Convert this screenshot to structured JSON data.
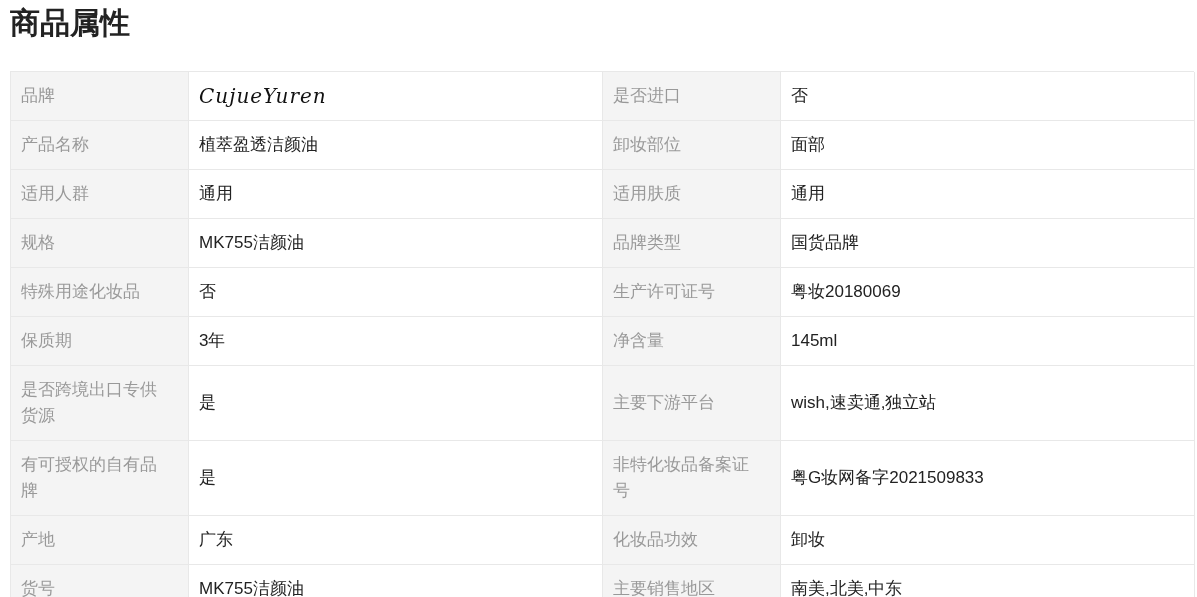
{
  "title": "商品属性",
  "rows": [
    {
      "cells": [
        {
          "label": "品牌",
          "value": "CujueYuren",
          "kind": "script"
        },
        {
          "label": "是否进口",
          "value": "否",
          "kind": "text"
        }
      ]
    },
    {
      "cells": [
        {
          "label": "产品名称",
          "value": "植萃盈透洁颜油",
          "kind": "text"
        },
        {
          "label": "卸妆部位",
          "value": "面部",
          "kind": "text"
        }
      ]
    },
    {
      "cells": [
        {
          "label": "适用人群",
          "value": "通用",
          "kind": "text"
        },
        {
          "label": "适用肤质",
          "value": "通用",
          "kind": "text"
        }
      ]
    },
    {
      "cells": [
        {
          "label": "规格",
          "value": "MK755洁颜油",
          "kind": "text"
        },
        {
          "label": "品牌类型",
          "value": "国货品牌",
          "kind": "text"
        }
      ]
    },
    {
      "cells": [
        {
          "label": "特殊用途化妆品",
          "value": "否",
          "kind": "text"
        },
        {
          "label": "生产许可证号",
          "value": "粤妆20180069",
          "kind": "text"
        }
      ]
    },
    {
      "cells": [
        {
          "label": "保质期",
          "value": "3年",
          "kind": "text"
        },
        {
          "label": "净含量",
          "value": "145ml",
          "kind": "text"
        }
      ]
    },
    {
      "cells": [
        {
          "label": "是否跨境出口专供货源",
          "value": "是",
          "kind": "text"
        },
        {
          "label": "主要下游平台",
          "value": "wish,速卖通,独立站",
          "kind": "text"
        }
      ]
    },
    {
      "cells": [
        {
          "label": "有可授权的自有品牌",
          "value": "是",
          "kind": "text"
        },
        {
          "label": "非特化妆品备案证号",
          "value": "粤G妆网备字2021509833",
          "kind": "text"
        }
      ]
    },
    {
      "cells": [
        {
          "label": "产地",
          "value": "广东",
          "kind": "text"
        },
        {
          "label": "化妆品功效",
          "value": "卸妆",
          "kind": "text"
        }
      ]
    },
    {
      "cells": [
        {
          "label": "货号",
          "value": "MK755洁颜油",
          "kind": "text"
        },
        {
          "label": "主要销售地区",
          "value": "南美,北美,中东",
          "kind": "text"
        }
      ]
    }
  ]
}
